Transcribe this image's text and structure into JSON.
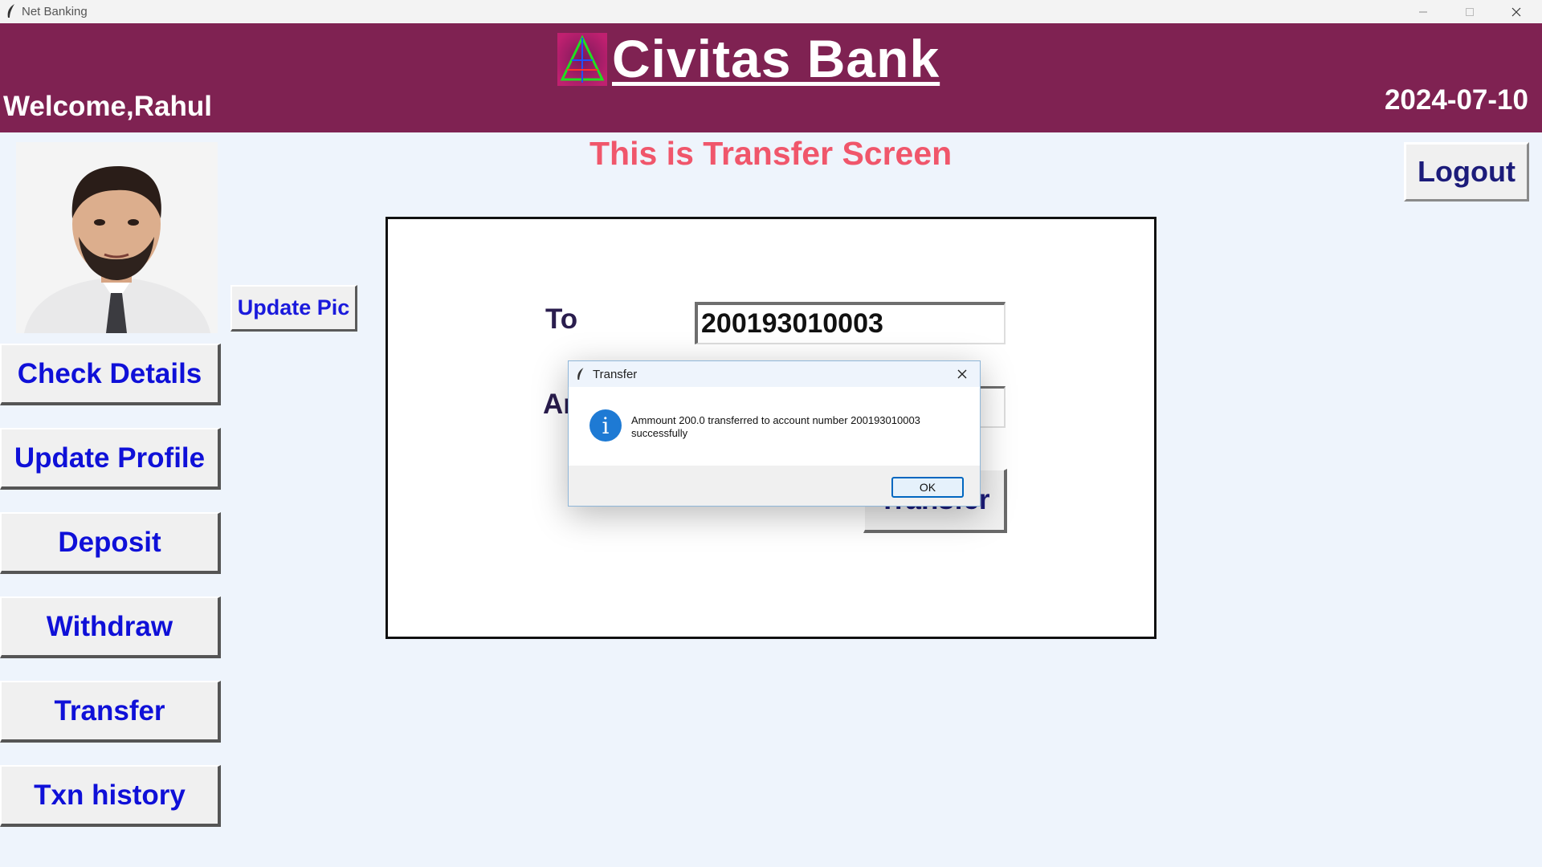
{
  "window": {
    "title": "Net Banking"
  },
  "header": {
    "bank_name": "Civitas Bank",
    "welcome": "Welcome,Rahul",
    "date": "2024-07-10",
    "color": "#7f2252"
  },
  "screen_title": "This is Transfer Screen",
  "logout_label": "Logout",
  "profile": {
    "update_pic_label": "Update Pic"
  },
  "nav": {
    "items": [
      {
        "label": "Check Details"
      },
      {
        "label": "Update Profile"
      },
      {
        "label": "Deposit"
      },
      {
        "label": "Withdraw"
      },
      {
        "label": "Transfer"
      },
      {
        "label": "Txn history"
      }
    ]
  },
  "form": {
    "to_label": "To",
    "amount_label": "Amount",
    "to_value": "200193010003",
    "transfer_label": "Transfer"
  },
  "dialog": {
    "title": "Transfer",
    "message": "Ammount 200.0 transferred to account number 200193010003 successfully",
    "ok_label": "OK",
    "icon": "info-icon"
  },
  "colors": {
    "accent_title": "#f0566b",
    "nav_text": "#0f10d8",
    "background": "#eef4fc"
  }
}
